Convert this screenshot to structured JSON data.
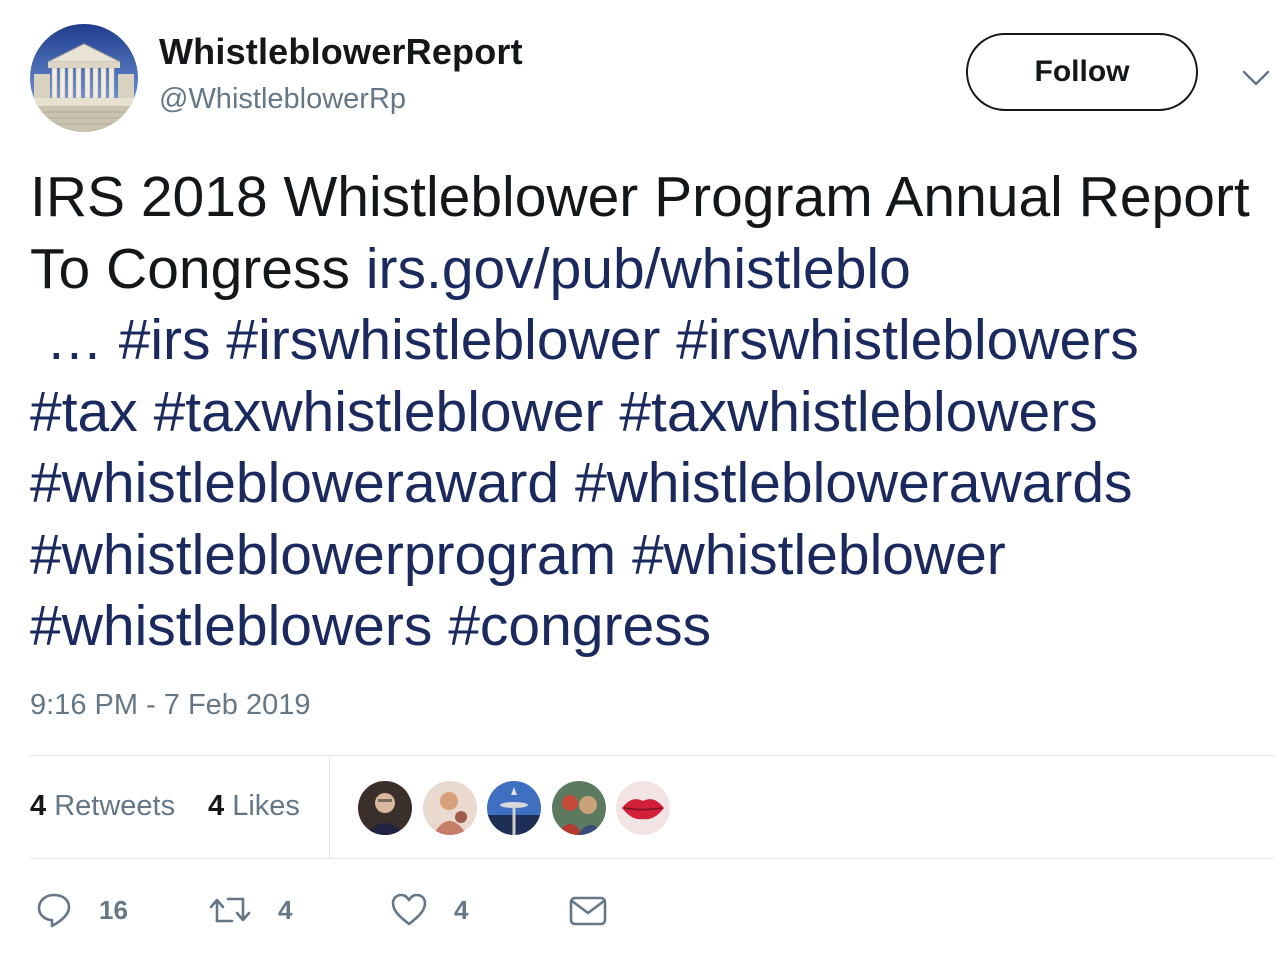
{
  "header": {
    "display_name": "WhistleblowerReport",
    "handle": "@WhistleblowerRp",
    "follow_label": "Follow"
  },
  "tweet": {
    "text_plain": "IRS 2018 Whistleblower Program Annual Report To Congress",
    "link": "irs.gov/pub/whistleblo",
    "link_ellipsis": "…",
    "hashtags": [
      "#irs",
      "#irswhistleblower",
      "#irswhistleblowers",
      "#tax",
      "#taxwhistleblower",
      "#taxwhistleblowers",
      "#whistlebloweraward",
      "#whistleblowerawards",
      "#whistleblowerprogram",
      "#whistleblower",
      "#whistleblowers",
      "#congress"
    ],
    "timestamp": "9:16 PM - 7 Feb 2019"
  },
  "stats": {
    "retweets_count": "4",
    "retweets_label": "Retweets",
    "likes_count": "4",
    "likes_label": "Likes"
  },
  "actions": {
    "reply_count": "16",
    "retweet_count": "4",
    "like_count": "4"
  },
  "colors": {
    "text": "#14171a",
    "secondary": "#657786",
    "link": "#1b2a5e",
    "divider": "#e1e8ed"
  }
}
